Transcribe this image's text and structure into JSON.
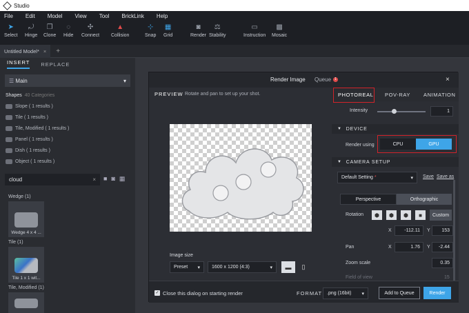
{
  "window": {
    "title": "Studio"
  },
  "menu": [
    "File",
    "Edit",
    "Model",
    "View",
    "Tool",
    "BrickLink",
    "Help"
  ],
  "toolbar": [
    "Select",
    "Hinge",
    "Clone",
    "Hide",
    "Connect",
    "Collision",
    "Snap",
    "Grid",
    "Render",
    "Stability",
    "Instruction",
    "Mosaic"
  ],
  "doc_tab": {
    "label": "Untitled Model*",
    "close": "×",
    "add": "+"
  },
  "left_panel": {
    "tabs": [
      "INSERT",
      "REPLACE"
    ],
    "palette": "Main",
    "shapes_header": "Shapes",
    "shapes_count": "40 Categories",
    "categories": [
      "Slope ( 1 results )",
      "Tile ( 1 results )",
      "Tile, Modified ( 1 results )",
      "Panel ( 1 results )",
      "Dish ( 1 results )",
      "Object ( 1 results )"
    ],
    "search_value": "cloud",
    "results": [
      {
        "section": "Wedge (1)",
        "item": "Wedge 4 x 4 ..."
      },
      {
        "section": "Tile (1)",
        "item": "Tile 1 x 1 wit..."
      },
      {
        "section": "Tile, Modified (1)",
        "item": ""
      }
    ]
  },
  "dialog": {
    "title": "Render Image",
    "queue_label": "Queue",
    "queue_count": "1",
    "close": "×",
    "preview_label": "PREVIEW",
    "preview_hint": "Rotate and pan to set up your shot.",
    "image_size_label": "Image size",
    "preset": "Preset",
    "resolution": "1600 x 1200 (4:3)",
    "close_on_start_label": "Close this dialog on starting render",
    "format_label": "FORMAT",
    "format_value": ".png (16bit)",
    "add_to_queue": "Add to Queue",
    "render": "Render",
    "tabs": [
      "PHOTOREAL",
      "POV-RAY",
      "ANIMATION"
    ],
    "intensity_label": "Intensity",
    "intensity_value": "1",
    "device_header": "DEVICE",
    "render_using_label": "Render using",
    "device_options": [
      "CPU",
      "GPU"
    ],
    "device_selected": "GPU",
    "camera_header": "CAMERA SETUP",
    "camera_setting": "Default Setting",
    "camera_required": "*",
    "save": "Save",
    "save_as": "Save as",
    "projection_options": [
      "Perspective",
      "Orthographic"
    ],
    "projection_selected": "Orthographic",
    "rotation_label": "Rotation",
    "custom": "Custom",
    "x_label": "X",
    "y_label": "Y",
    "rotation_x": "-112.11",
    "rotation_y": "153",
    "pan_label": "Pan",
    "pan_x": "1.76",
    "pan_y": "-2.44",
    "zoom_label": "Zoom scale",
    "zoom_value": "0.35",
    "fov_label": "Field of view",
    "fov_value": "15"
  },
  "colors": {
    "accent": "#3ea5e8",
    "highlight": "#d2232a",
    "render_button": "#3ea5e8"
  }
}
